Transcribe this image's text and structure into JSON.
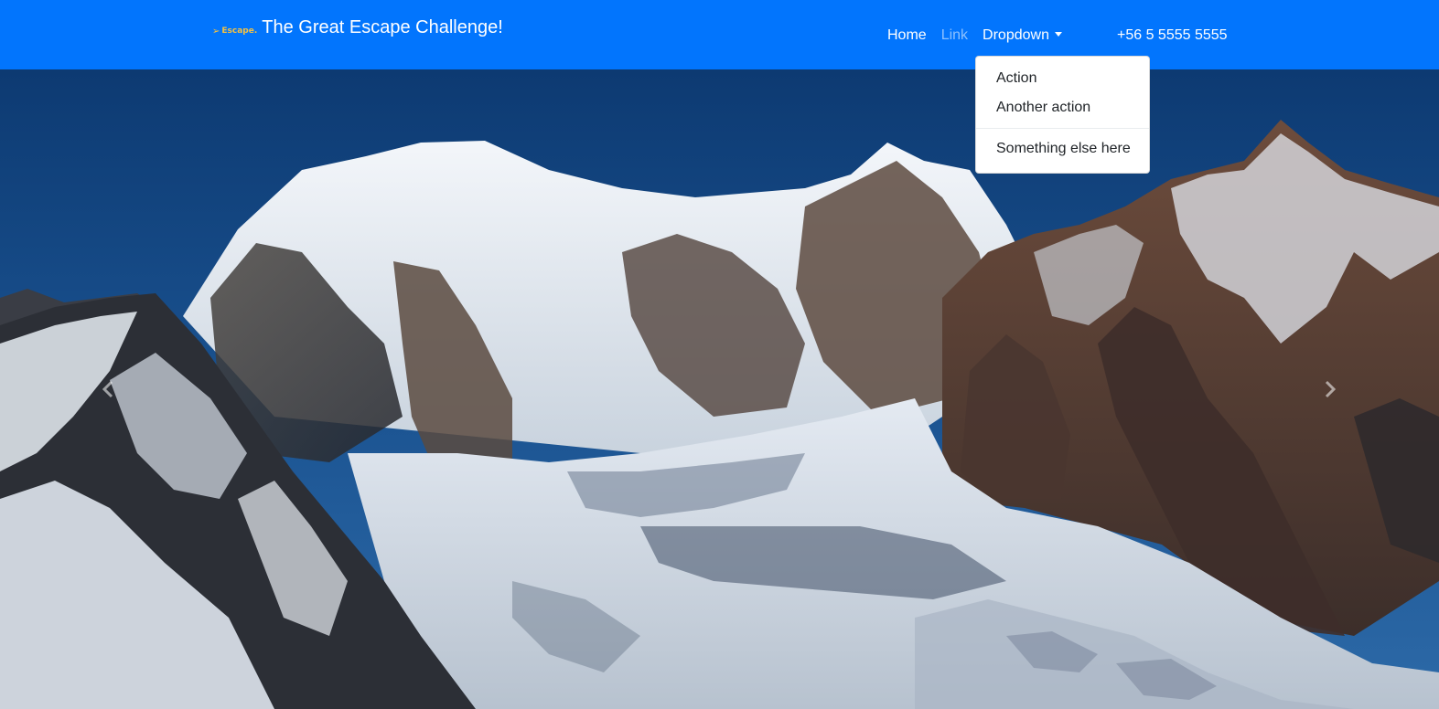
{
  "navbar": {
    "logo_text": "Escape.",
    "brand_title": "The Great Escape Challenge!",
    "links": [
      {
        "label": "Home",
        "active": true
      },
      {
        "label": "Link",
        "active": false
      },
      {
        "label": "Dropdown",
        "active": true
      }
    ],
    "phone": "+56 5 5555 5555",
    "background_color": "#0275fd"
  },
  "dropdown": {
    "items": [
      {
        "label": "Action"
      },
      {
        "label": "Another action"
      },
      {
        "label": "Something else here"
      }
    ]
  },
  "carousel": {
    "prev_icon": "chevron-left-icon",
    "next_icon": "chevron-right-icon"
  }
}
